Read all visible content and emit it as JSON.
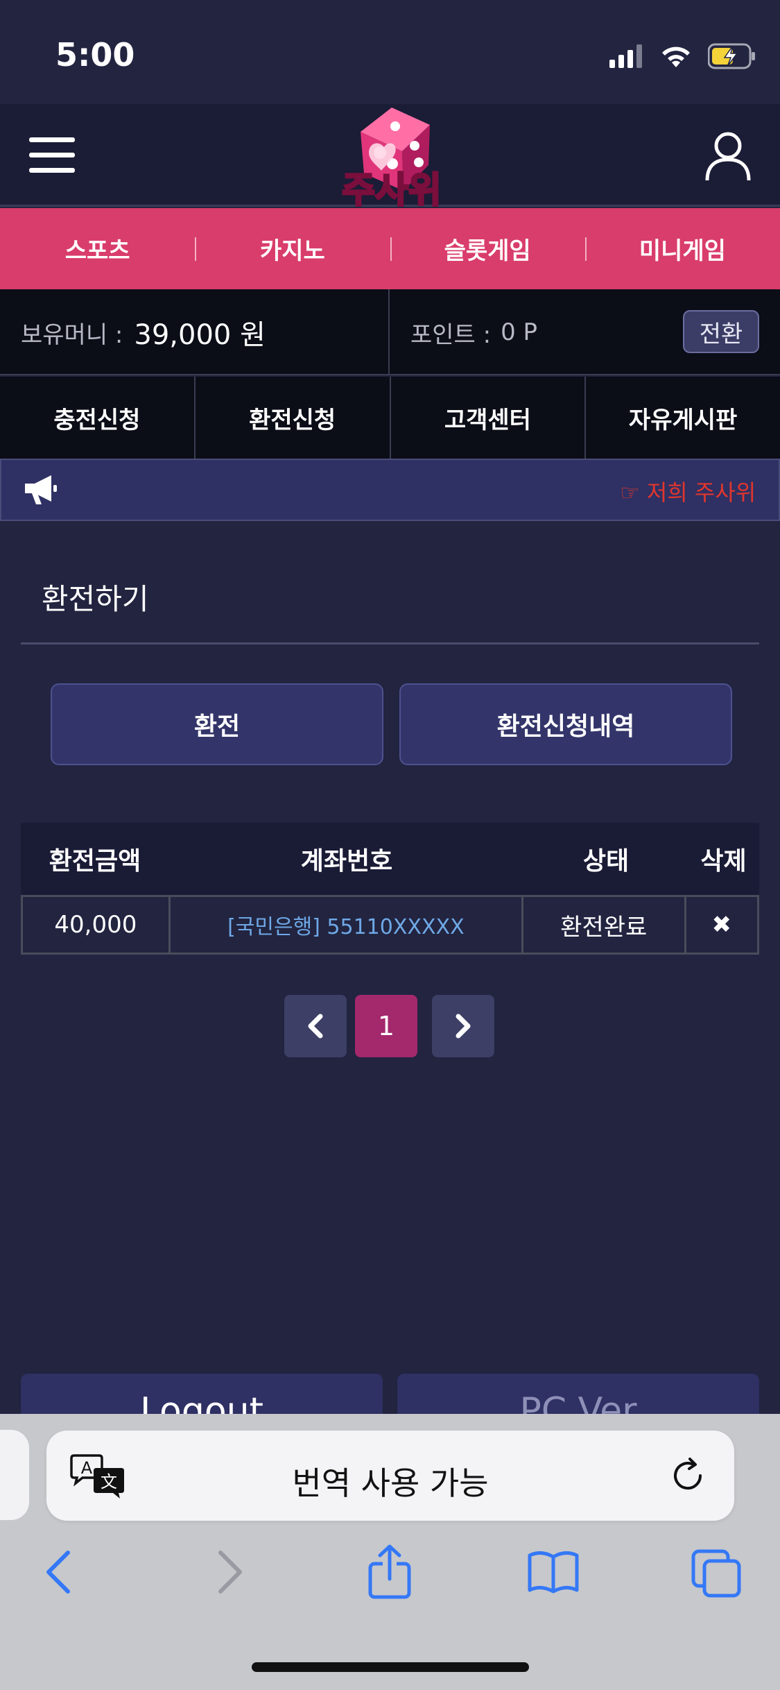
{
  "status_bar": {
    "time": "5:00"
  },
  "header": {
    "logo_text": "주사위"
  },
  "game_nav": {
    "items": [
      "스포츠",
      "카지노",
      "슬롯게임",
      "미니게임"
    ]
  },
  "money": {
    "label": "보유머니 :",
    "value": "39,000 원",
    "point_label": "포인트 :",
    "point_value": "0 P",
    "convert_label": "전환"
  },
  "action_nav": {
    "items": [
      "충전신청",
      "환전신청",
      "고객센터",
      "자유게시판"
    ]
  },
  "notice": {
    "text": "☞ 저희 주사위"
  },
  "page": {
    "title": "환전하기"
  },
  "tabs": {
    "exchange": "환전",
    "history": "환전신청내역"
  },
  "table": {
    "headers": [
      "환전금액",
      "계좌번호",
      "상태",
      "삭제"
    ],
    "rows": [
      {
        "amount": "40,000",
        "account": "[국민은행] 55110XXXXX",
        "status": "환전완료",
        "delete": "✖"
      }
    ]
  },
  "pagination": {
    "current": "1"
  },
  "footer": {
    "logout": "Logout",
    "pc_ver": "PC Ver"
  },
  "browser": {
    "translate_text": "번역 사용 가능"
  },
  "colors": {
    "bg": "#222440",
    "accent": "#d93d6b",
    "page_current": "#a3286c",
    "notice_text": "#e0362e",
    "link": "#6fa8e6"
  }
}
